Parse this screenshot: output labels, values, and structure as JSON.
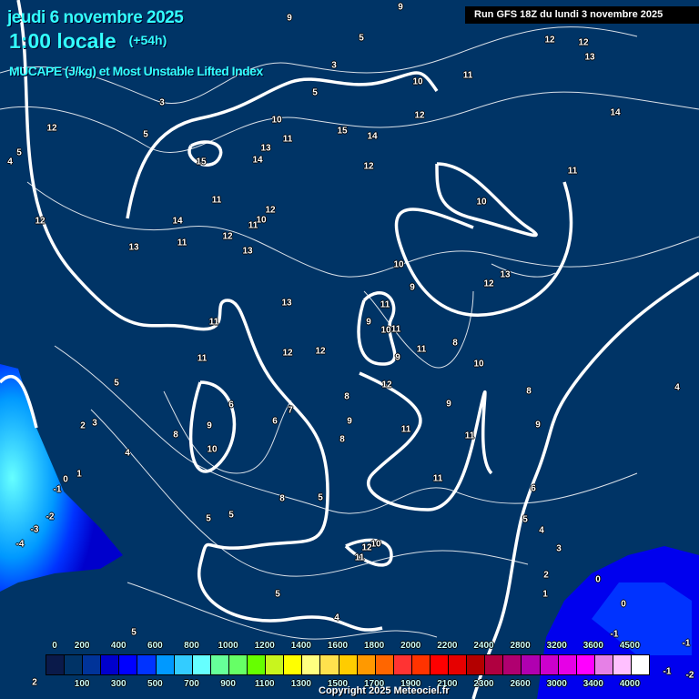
{
  "header": {
    "date": "jeudi 6 novembre 2025",
    "time": "1:00 locale",
    "lead": "(+54h)",
    "parameter": "MUCAPE (J/kg) et Most Unstable Lifted Index",
    "run": "Run GFS 18Z du lundi 3 novembre 2025"
  },
  "contour_labels": [
    "9",
    "9",
    "5",
    "12",
    "12",
    "13",
    "3",
    "10",
    "11",
    "5",
    "3",
    "12",
    "5",
    "10",
    "11",
    "13",
    "15",
    "14",
    "12",
    "14",
    "5",
    "4",
    "15",
    "14",
    "12",
    "11",
    "11",
    "12",
    "10",
    "11",
    "10",
    "12",
    "14",
    "12",
    "11",
    "13",
    "13",
    "10",
    "13",
    "12",
    "9",
    "13",
    "11",
    "11",
    "9",
    "10",
    "11",
    "11",
    "12",
    "12",
    "8",
    "9",
    "11",
    "10",
    "5",
    "12",
    "8",
    "4",
    "6",
    "8",
    "9",
    "7",
    "6",
    "9",
    "9",
    "2",
    "3",
    "8",
    "11",
    "9",
    "11",
    "8",
    "10",
    "4",
    "0",
    "1",
    "11",
    "-1",
    "6",
    "8",
    "5",
    "-2",
    "5",
    "5",
    "5",
    "4",
    "-3",
    "-4",
    "3",
    "10",
    "12",
    "11",
    "2",
    "0",
    "1",
    "5",
    "0",
    "4",
    "5",
    "-1",
    "-1",
    "-1",
    "-2",
    "2"
  ],
  "legend": {
    "top_labels": [
      "0",
      "200",
      "400",
      "600",
      "800",
      "1000",
      "1200",
      "1400",
      "1600",
      "1800",
      "2000",
      "2200",
      "2400",
      "2800",
      "3200",
      "3600",
      "4500"
    ],
    "bottom_labels": [
      "100",
      "300",
      "500",
      "700",
      "900",
      "1100",
      "1300",
      "1500",
      "1700",
      "1900",
      "2100",
      "2300",
      "2600",
      "3000",
      "3400",
      "4000"
    ],
    "colors": [
      "#0a1a4a",
      "#003366",
      "#003399",
      "#0000cc",
      "#0000ff",
      "#0033ff",
      "#0099ff",
      "#33ccff",
      "#66ffff",
      "#66ff99",
      "#66ff66",
      "#66ff00",
      "#c8f51e",
      "#ffff00",
      "#ffff80",
      "#ffe14d",
      "#ffcc00",
      "#ff9900",
      "#ff6600",
      "#ff3333",
      "#ff3300",
      "#ff0000",
      "#e60000",
      "#b30000",
      "#b00040",
      "#b00070",
      "#b000b0",
      "#cc00cc",
      "#e600e6",
      "#ff00ff",
      "#e680e6",
      "#ffc0ff",
      "#ffffff"
    ]
  },
  "copyright": "Copyright 2025 Meteociel.fr"
}
